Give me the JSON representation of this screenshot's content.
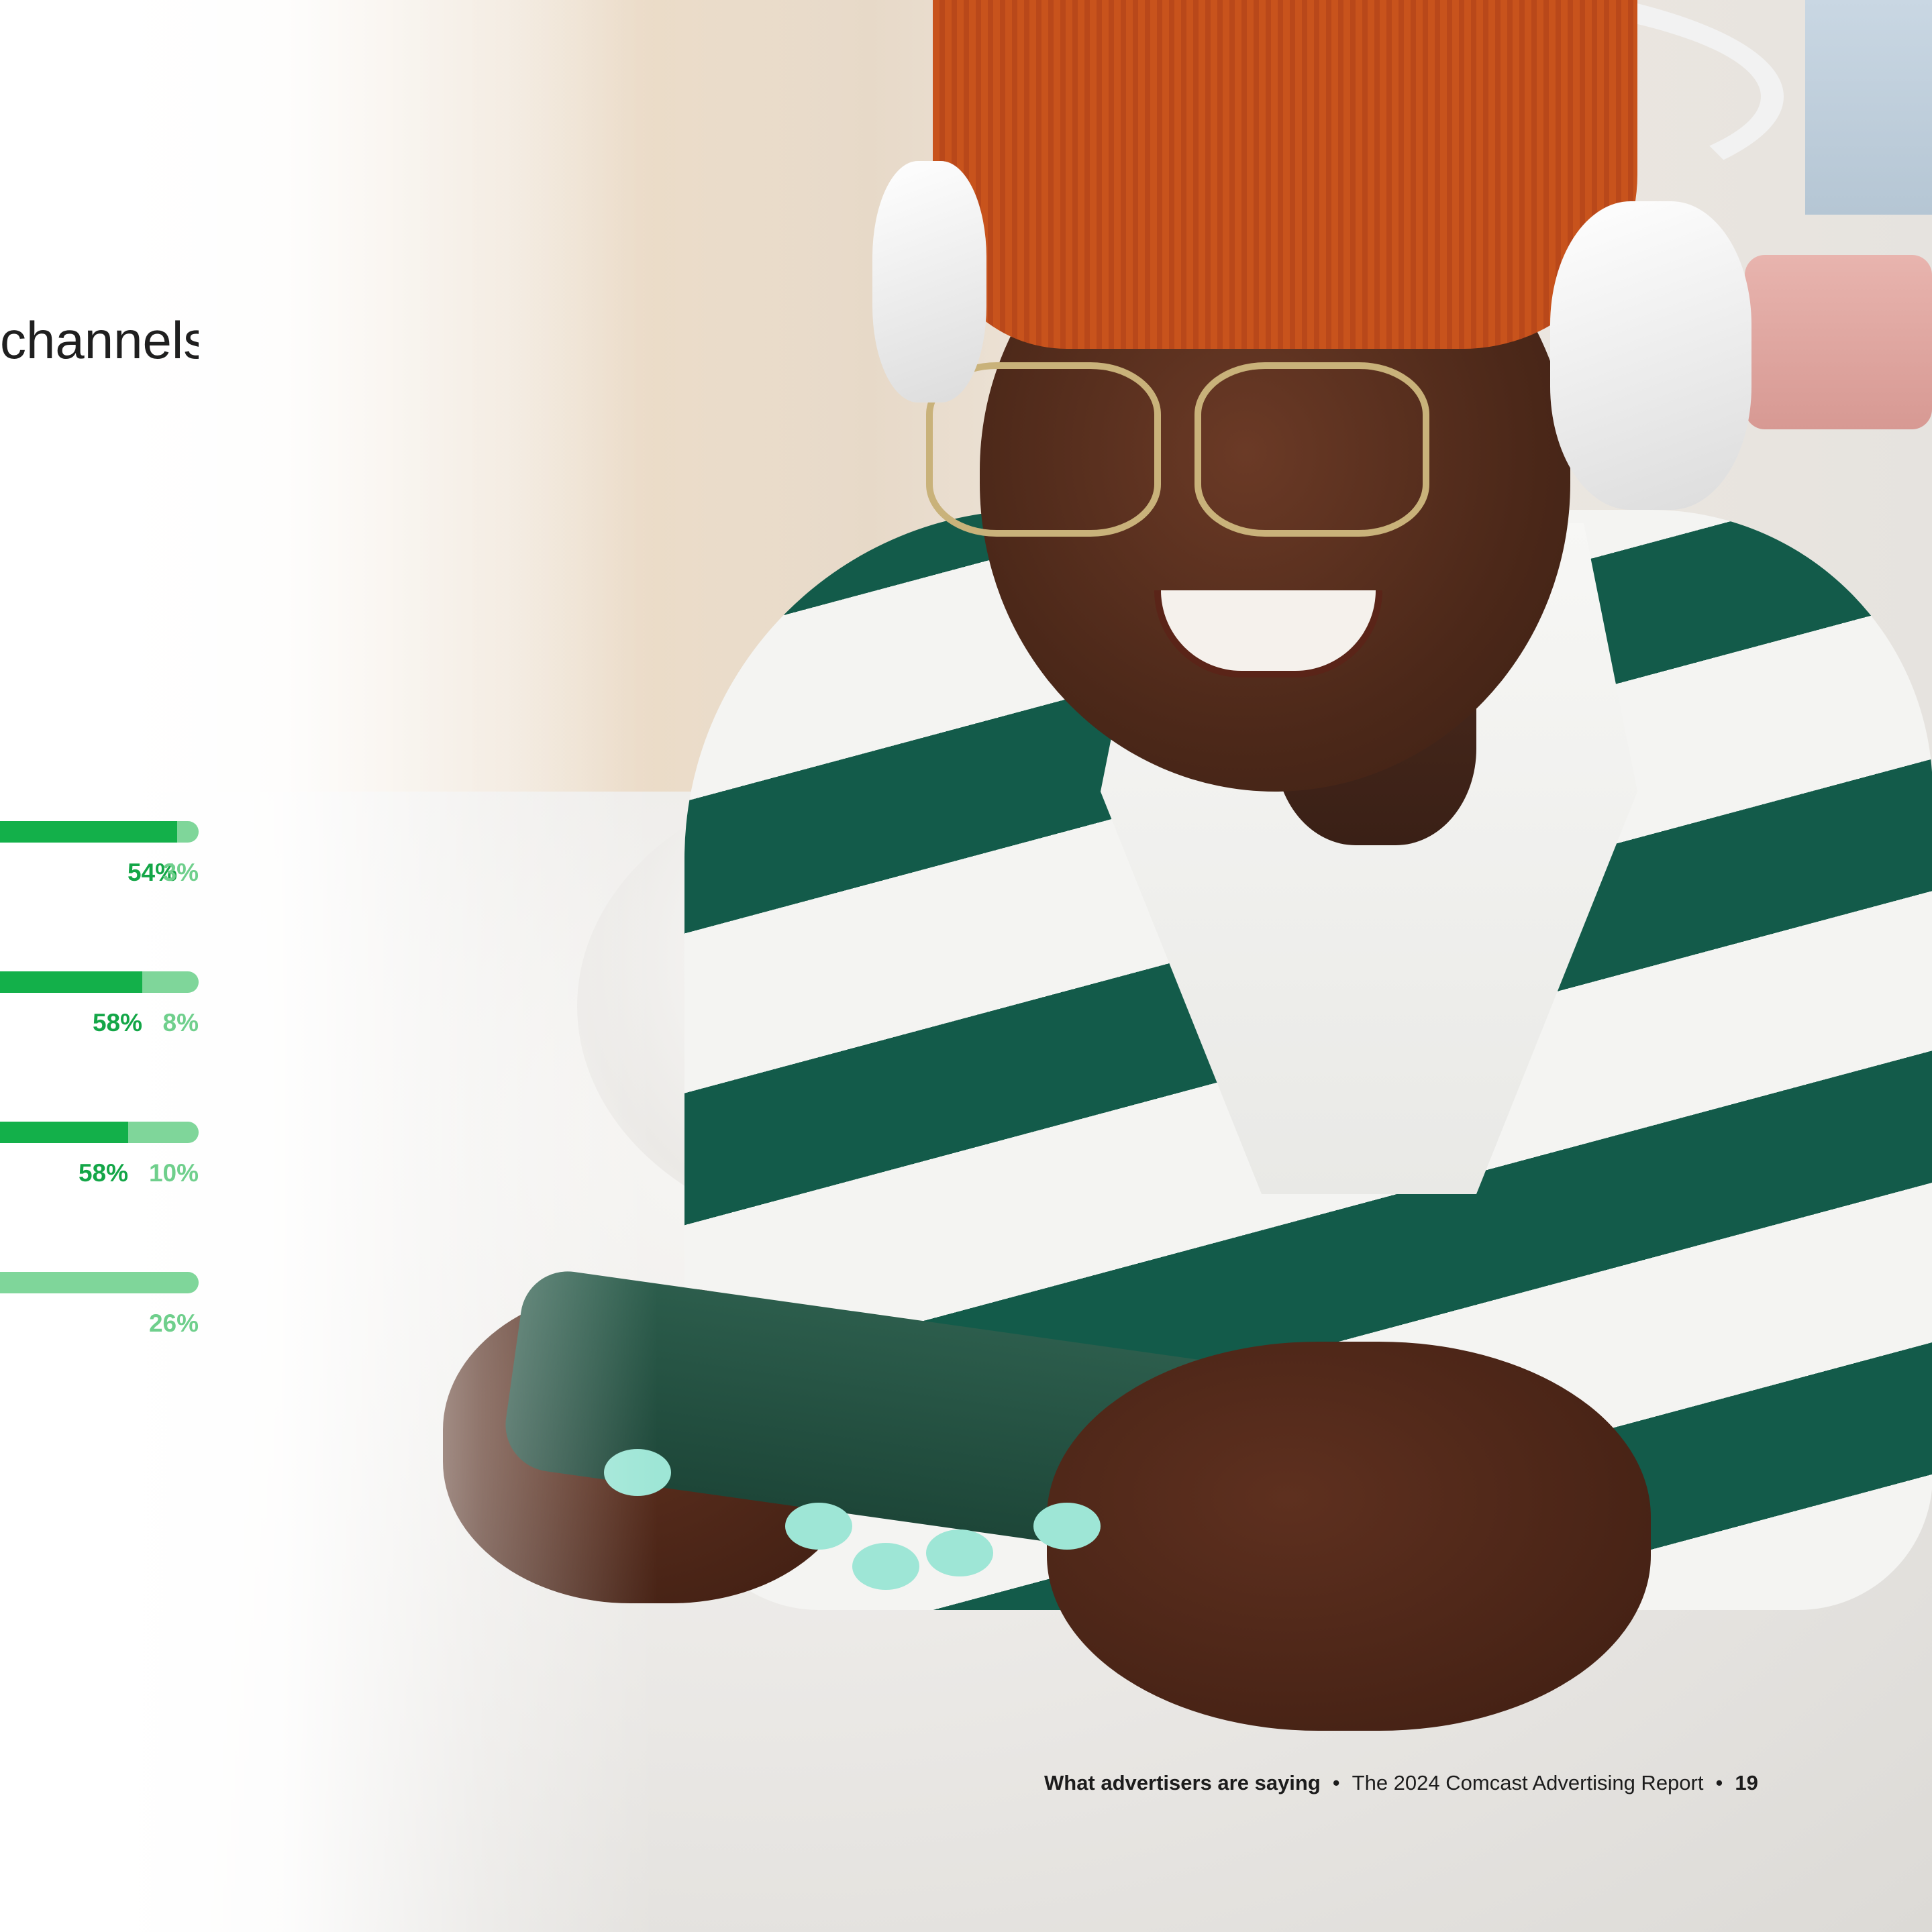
{
  "headline": "channels",
  "bars": [
    {
      "primary": 0.54,
      "secondary": 0.03,
      "primary_label": "54%",
      "secondary_label": "3%"
    },
    {
      "primary": 0.58,
      "secondary": 0.08,
      "primary_label": "58%",
      "secondary_label": "8%"
    },
    {
      "primary": 0.58,
      "secondary": 0.1,
      "primary_label": "58%",
      "secondary_label": "10%"
    },
    {
      "primary": null,
      "secondary": 0.26,
      "primary_label": "",
      "secondary_label": "26%"
    }
  ],
  "colors": {
    "primary_bar": "#13b04a",
    "secondary_bar": "#7fd69a",
    "primary_text": "#13a647",
    "secondary_text": "#6fcf8c"
  },
  "footer": {
    "section": "What advertisers are saying",
    "separator": "•",
    "report": "The 2024 Comcast Advertising Report",
    "page_number": "19"
  }
}
